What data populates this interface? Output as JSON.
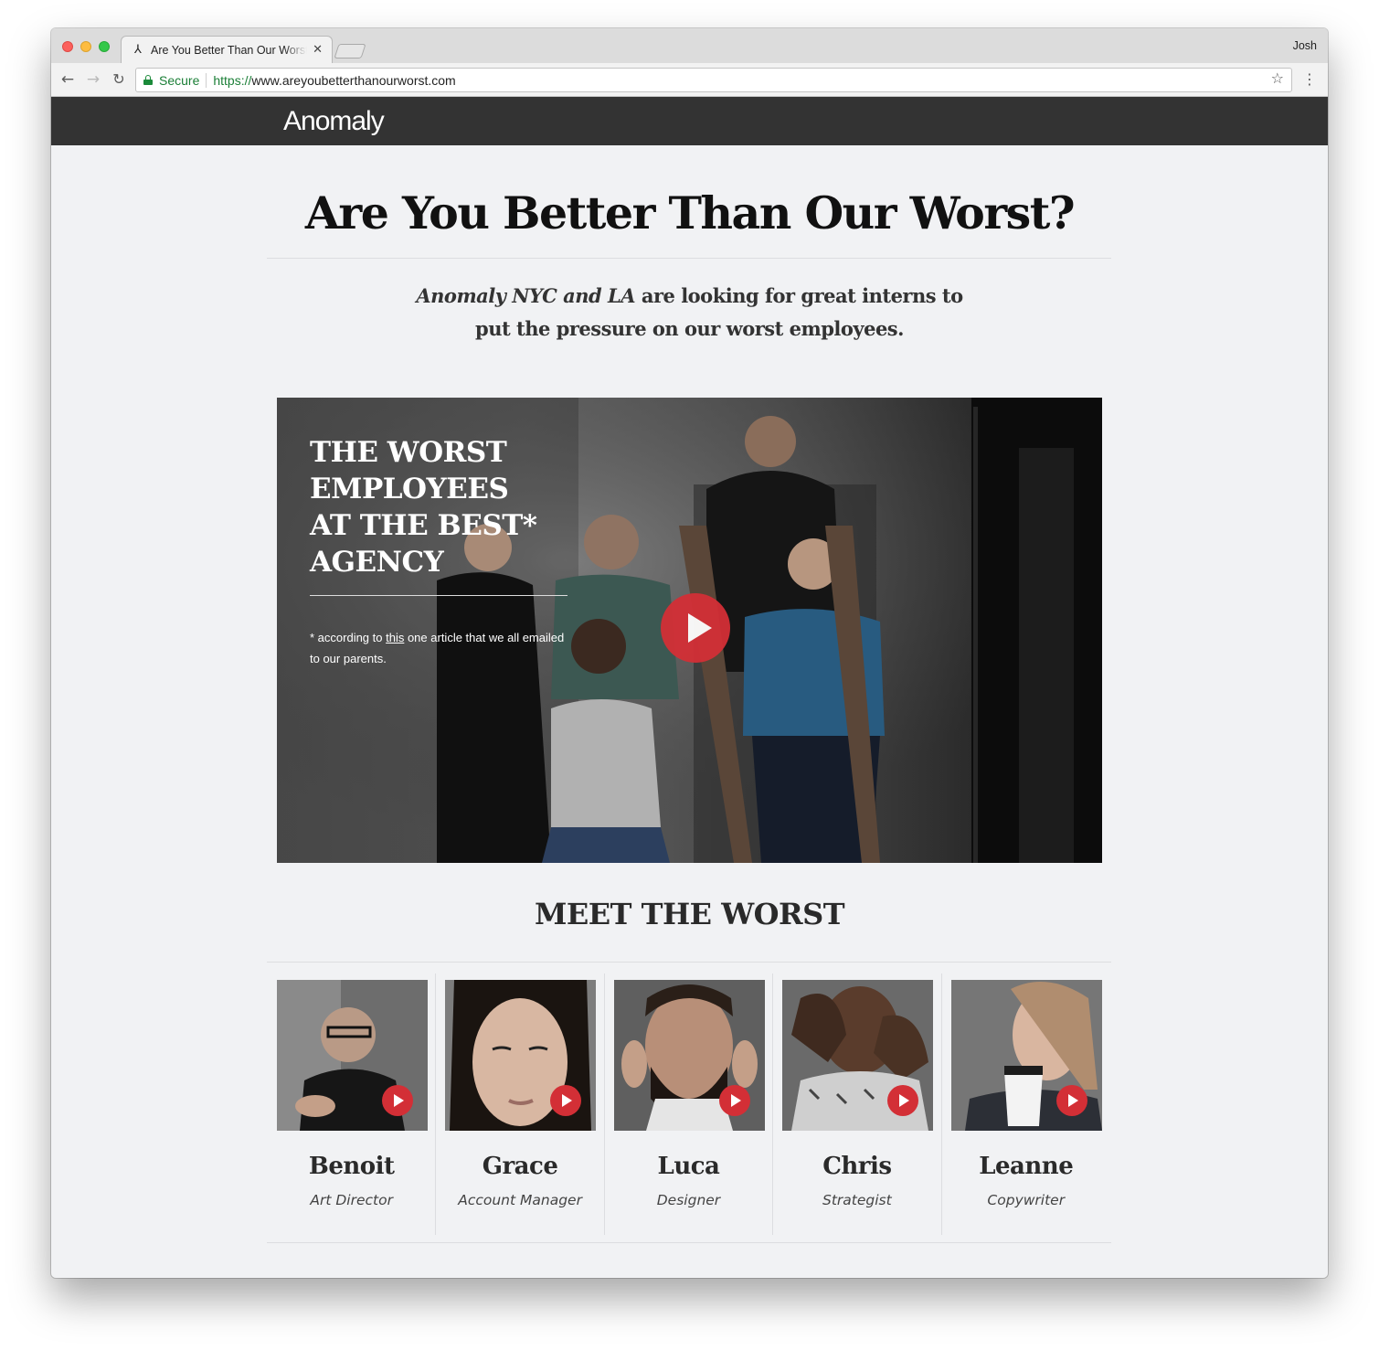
{
  "browser": {
    "tab_title": "Are You Better Than Our Worst?",
    "tab_favicon": "anomaly-favicon-icon",
    "profile_name": "Josh",
    "secure_label": "Secure",
    "url_scheme": "https://",
    "url_rest": "www.areyoubetterthanourworst.com"
  },
  "site": {
    "logo_text": "Anomaly"
  },
  "hero": {
    "title": "Are You Better Than Our Worst?",
    "subtitle_line1_em": "Anomaly NYC and LA",
    "subtitle_line1_rest": " are looking for great interns to",
    "subtitle_line2": "put the pressure on our worst employees."
  },
  "video": {
    "heading_lines": [
      "THE WORST",
      "EMPLOYEES",
      "AT THE BEST*",
      "AGENCY"
    ],
    "note_prefix": "* according to ",
    "note_link": "this",
    "note_suffix": " one article that we all emailed to our parents."
  },
  "meet": {
    "title": "MEET THE WORST",
    "members": [
      {
        "name": "Benoit",
        "role": "Art Director"
      },
      {
        "name": "Grace",
        "role": "Account Manager"
      },
      {
        "name": "Luca",
        "role": "Designer"
      },
      {
        "name": "Chris",
        "role": "Strategist"
      },
      {
        "name": "Leanne",
        "role": "Copywriter"
      }
    ]
  },
  "colors": {
    "accent_red": "#d32f36",
    "header_bg": "#333333",
    "page_bg": "#f1f2f4"
  }
}
